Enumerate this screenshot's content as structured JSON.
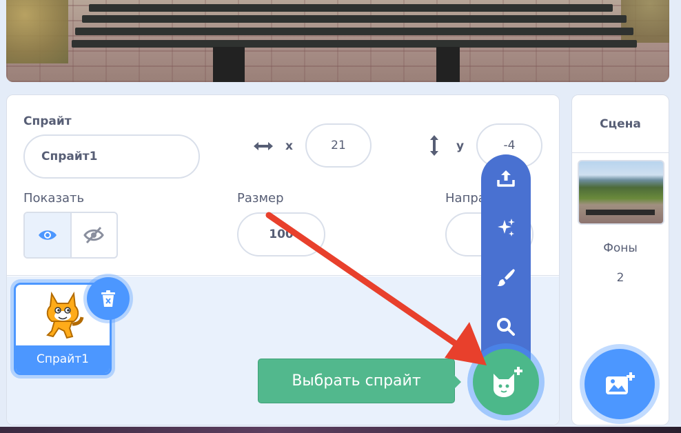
{
  "sprite_info": {
    "title": "Спрайт",
    "name_value": "Спрайт1",
    "x_label": "x",
    "x_value": "21",
    "y_label": "y",
    "y_value": "-4",
    "show_label": "Показать",
    "size_label": "Размер",
    "size_value": "100",
    "direction_label": "Напра"
  },
  "sprites": [
    {
      "name": "Спрайт1",
      "selected": true
    }
  ],
  "sprite_chooser": {
    "tooltip": "Выбрать спрайт",
    "menu": [
      "upload-icon",
      "surprise-icon",
      "paint-icon",
      "search-icon"
    ]
  },
  "stage_panel": {
    "title": "Сцена",
    "backdrops_label": "Фоны",
    "backdrops_count": "2"
  },
  "colors": {
    "accent": "#4c97ff",
    "chooser_green": "#4cb88a",
    "flyout_blue": "#4971d1",
    "annotation_arrow": "#e8402c"
  }
}
